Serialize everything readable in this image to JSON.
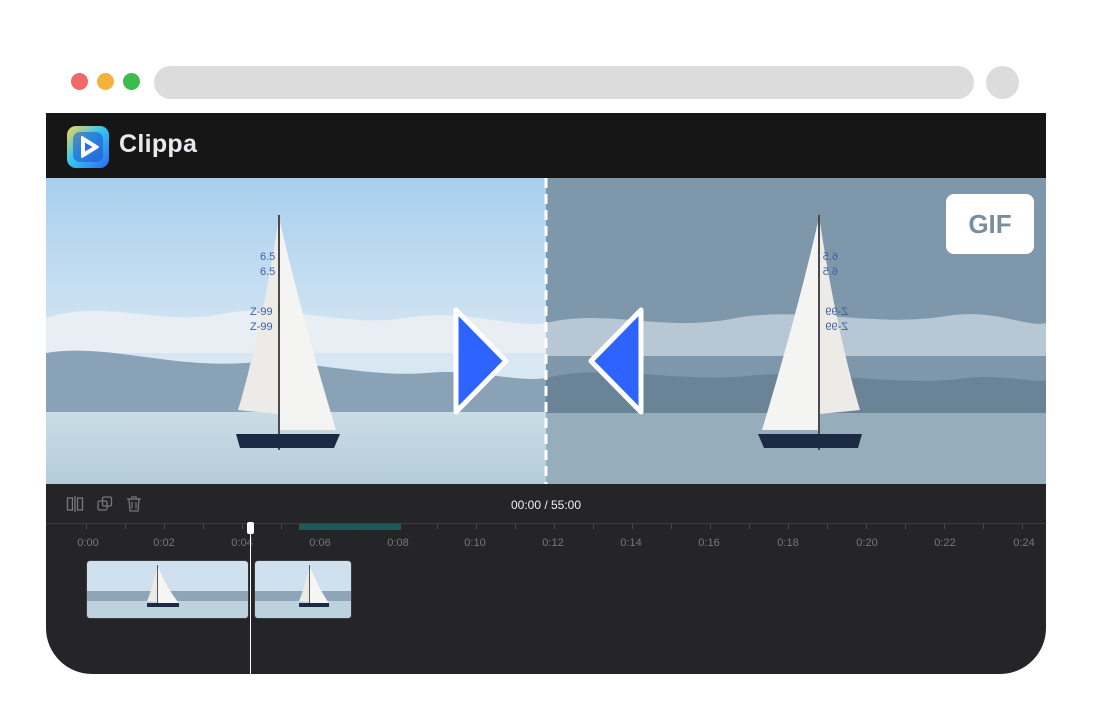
{
  "browser": {
    "controls": [
      "close",
      "minimize",
      "maximize"
    ]
  },
  "app": {
    "name": "Clippa",
    "logo_icon": "clippa-play-logo-icon"
  },
  "preview": {
    "badge": "GIF",
    "overlay_icons": [
      "play-right-arrow-icon",
      "play-left-arrow-icon"
    ],
    "colors": {
      "arrow": "#2f63ff",
      "divider": "#ffffff"
    }
  },
  "toolbar": {
    "icons": [
      "split-icon",
      "duplicate-icon",
      "delete-icon"
    ],
    "time": "00:00 / 55:00"
  },
  "timeline": {
    "ticks": [
      "0:00",
      "0:02",
      "0:04",
      "0:06",
      "0:08",
      "0:10",
      "0:12",
      "0:14",
      "0:16",
      "0:18",
      "0:20",
      "0:22",
      "0:24"
    ],
    "clips": [
      "sailboat-clip-1",
      "sailboat-clip-2"
    ]
  }
}
